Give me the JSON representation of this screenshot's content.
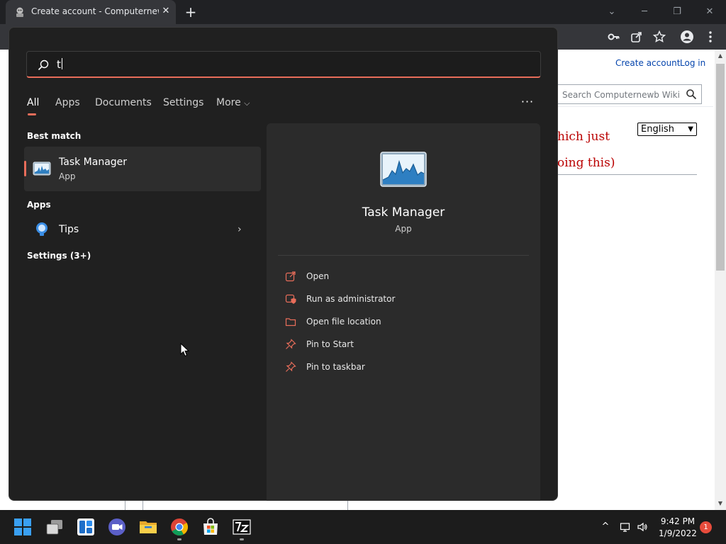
{
  "browser": {
    "tab_title": "Create account - Computernewb",
    "tab_close": "✕",
    "new_tab": "+",
    "window_controls": {
      "minimize": "─",
      "restore": "❐",
      "close": "✕",
      "dropdown": "⌄"
    }
  },
  "page": {
    "create_account": "Create account",
    "log_in": "Log in",
    "search_placeholder": "Search Computernewb Wiki",
    "language_selected": "English",
    "language_caret": "▼",
    "text_line1": "hich just",
    "text_line2": "oing this)",
    "scroll_up": "▲",
    "scroll_down": "▼"
  },
  "search": {
    "query": "t",
    "filters": [
      "All",
      "Apps",
      "Documents",
      "Settings",
      "More"
    ],
    "more_caret": "⌵",
    "more_options": "···",
    "best_match_header": "Best match",
    "best_match": {
      "title": "Task Manager",
      "type": "App"
    },
    "apps_header": "Apps",
    "apps": [
      {
        "title": "Tips",
        "chevron": "›"
      }
    ],
    "settings_header": "Settings (3+)",
    "detail": {
      "title": "Task Manager",
      "type": "App",
      "actions": [
        "Open",
        "Run as administrator",
        "Open file location",
        "Pin to Start",
        "Pin to taskbar"
      ]
    }
  },
  "taskbar": {
    "time": "9:42 PM",
    "date": "1/9/2022",
    "notification_count": "1",
    "tray": {
      "chevron": "^",
      "network": "▭",
      "volume": "🔈"
    }
  },
  "colors": {
    "accent": "#e86d5a",
    "panel_bg": "#202020",
    "detail_bg": "#2b2b2b",
    "link": "#0645ad",
    "red_text": "#ba0000"
  }
}
